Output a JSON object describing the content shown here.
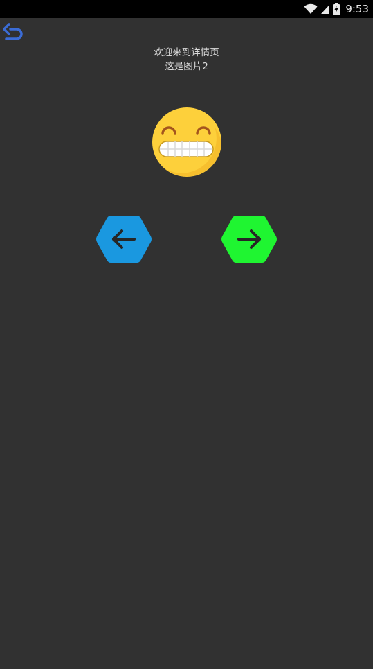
{
  "status_bar": {
    "time": "9:53",
    "icons": [
      "wifi-icon",
      "signal-icon",
      "battery-icon"
    ]
  },
  "back_button": {
    "icon": "undo-arrow-icon",
    "color": "#3b6cd6"
  },
  "header": {
    "line1": "欢迎来到详情页",
    "line2": "这是图片2"
  },
  "image": {
    "icon": "grinning-face-emoji"
  },
  "nav": {
    "prev": {
      "icon": "arrow-left-icon",
      "color": "#1a98e0"
    },
    "next": {
      "icon": "arrow-right-icon",
      "color": "#1ff531"
    }
  },
  "colors": {
    "background": "#313131",
    "status_bar": "#000000",
    "text": "#dcdcdc"
  }
}
